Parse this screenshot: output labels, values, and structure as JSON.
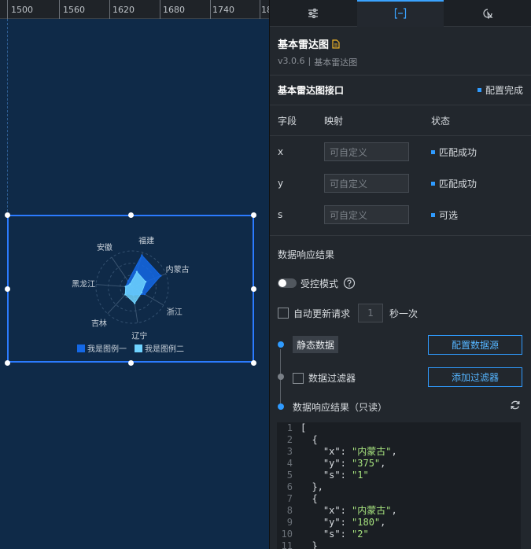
{
  "ruler": {
    "ticks": [
      "1500",
      "1560",
      "1620",
      "1680",
      "1740",
      "18"
    ]
  },
  "chart_data": {
    "type": "radar",
    "indicators": [
      "福建",
      "内蒙古",
      "浙江",
      "辽宁",
      "吉林",
      "黑龙江",
      "安徽"
    ],
    "series": [
      {
        "name": "我是图例一",
        "color": "#1468e6",
        "values": [
          92,
          85,
          40,
          22,
          25,
          18,
          20
        ]
      },
      {
        "name": "我是图例二",
        "color": "#6fd3ff",
        "values": [
          44,
          40,
          30,
          45,
          28,
          18,
          10
        ]
      }
    ],
    "max": 100
  },
  "panel": {
    "tabs": [
      "settings",
      "data",
      "interaction"
    ],
    "title": "基本雷达图",
    "version": "v3.0.6",
    "separator": "|",
    "subtitle": "基本雷达图",
    "api_title": "基本雷达图接口",
    "api_status": "配置完成",
    "columns": {
      "field": "字段",
      "mapping": "映射",
      "status": "状态"
    },
    "fields": [
      {
        "name": "x",
        "placeholder": "可自定义",
        "status": "匹配成功"
      },
      {
        "name": "y",
        "placeholder": "可自定义",
        "status": "匹配成功"
      },
      {
        "name": "s",
        "placeholder": "可自定义",
        "status": "可选"
      }
    ],
    "response_title": "数据响应结果",
    "controlled_mode": "受控模式",
    "auto_update": "自动更新请求",
    "interval_value": "1",
    "interval_unit": "秒一次",
    "static_data": "静态数据",
    "config_source_button": "配置数据源",
    "filter_label": "数据过滤器",
    "add_filter_button": "添加过滤器",
    "result_label": "数据响应结果（只读）",
    "code": [
      {
        "n": "1",
        "parts": [
          [
            "txt",
            "["
          ]
        ]
      },
      {
        "n": "2",
        "parts": [
          [
            "txt",
            "  {"
          ]
        ]
      },
      {
        "n": "3",
        "parts": [
          [
            "txt",
            "    \"x\": "
          ],
          [
            "str",
            "\"内蒙古\""
          ],
          [
            "txt",
            ","
          ]
        ]
      },
      {
        "n": "4",
        "parts": [
          [
            "txt",
            "    \"y\": "
          ],
          [
            "str",
            "\"375\""
          ],
          [
            "txt",
            ","
          ]
        ]
      },
      {
        "n": "5",
        "parts": [
          [
            "txt",
            "    \"s\": "
          ],
          [
            "str",
            "\"1\""
          ]
        ]
      },
      {
        "n": "6",
        "parts": [
          [
            "txt",
            "  },"
          ]
        ]
      },
      {
        "n": "7",
        "parts": [
          [
            "txt",
            "  {"
          ]
        ]
      },
      {
        "n": "8",
        "parts": [
          [
            "txt",
            "    \"x\": "
          ],
          [
            "str",
            "\"内蒙古\""
          ],
          [
            "txt",
            ","
          ]
        ]
      },
      {
        "n": "9",
        "parts": [
          [
            "txt",
            "    \"y\": "
          ],
          [
            "str",
            "\"180\""
          ],
          [
            "txt",
            ","
          ]
        ]
      },
      {
        "n": "10",
        "parts": [
          [
            "txt",
            "    \"s\": "
          ],
          [
            "str",
            "\"2\""
          ]
        ]
      },
      {
        "n": "11",
        "parts": [
          [
            "txt",
            "  }"
          ]
        ]
      }
    ]
  }
}
